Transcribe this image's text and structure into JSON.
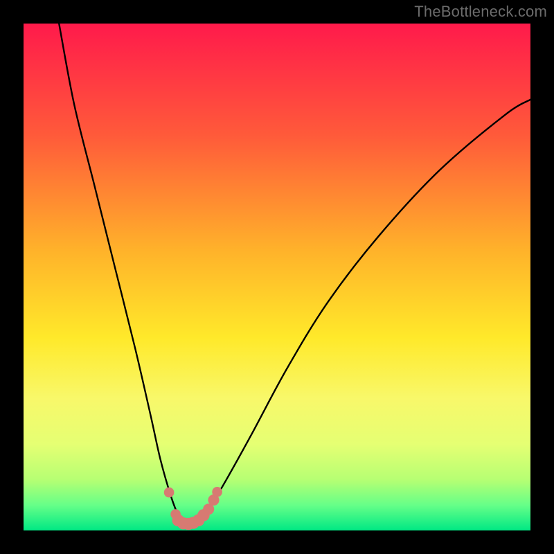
{
  "watermark": "TheBottleneck.com",
  "chart_data": {
    "type": "line",
    "title": "",
    "xlabel": "",
    "ylabel": "",
    "xlim": [
      0,
      100
    ],
    "ylim": [
      0,
      100
    ],
    "grid": false,
    "legend": false,
    "gradient_stops": [
      {
        "offset": 0.0,
        "color": "#ff1a4b"
      },
      {
        "offset": 0.22,
        "color": "#ff5a3a"
      },
      {
        "offset": 0.45,
        "color": "#ffb32a"
      },
      {
        "offset": 0.62,
        "color": "#ffe92a"
      },
      {
        "offset": 0.74,
        "color": "#f8f86a"
      },
      {
        "offset": 0.83,
        "color": "#e5ff73"
      },
      {
        "offset": 0.9,
        "color": "#b6ff73"
      },
      {
        "offset": 0.95,
        "color": "#66ff88"
      },
      {
        "offset": 1.0,
        "color": "#00e884"
      }
    ],
    "series": [
      {
        "name": "bottleneck-curve",
        "x": [
          7,
          10,
          14,
          18,
          22,
          25,
          27,
          29,
          30.5,
          31.5,
          32.5,
          33.5,
          35,
          37,
          40,
          45,
          52,
          60,
          70,
          82,
          95,
          100
        ],
        "y": [
          100,
          84,
          68,
          52,
          36,
          23,
          14,
          7,
          3,
          1.5,
          1.3,
          1.5,
          2.5,
          5,
          10,
          19,
          32,
          45,
          58,
          71,
          82,
          85
        ]
      }
    ],
    "markers": {
      "name": "highlight-dots",
      "color": "#d77a72",
      "points": [
        {
          "x": 28.7,
          "y": 7.5,
          "r": 1.0
        },
        {
          "x": 30.0,
          "y": 3.2,
          "r": 1.0
        },
        {
          "x": 30.5,
          "y": 2.0,
          "r": 1.2
        },
        {
          "x": 31.5,
          "y": 1.4,
          "r": 1.2
        },
        {
          "x": 32.5,
          "y": 1.3,
          "r": 1.2
        },
        {
          "x": 33.5,
          "y": 1.5,
          "r": 1.2
        },
        {
          "x": 34.5,
          "y": 2.0,
          "r": 1.2
        },
        {
          "x": 35.5,
          "y": 3.0,
          "r": 1.2
        },
        {
          "x": 36.5,
          "y": 4.2,
          "r": 1.1
        },
        {
          "x": 37.5,
          "y": 6.0,
          "r": 1.1
        },
        {
          "x": 38.2,
          "y": 7.6,
          "r": 1.0
        }
      ]
    }
  }
}
